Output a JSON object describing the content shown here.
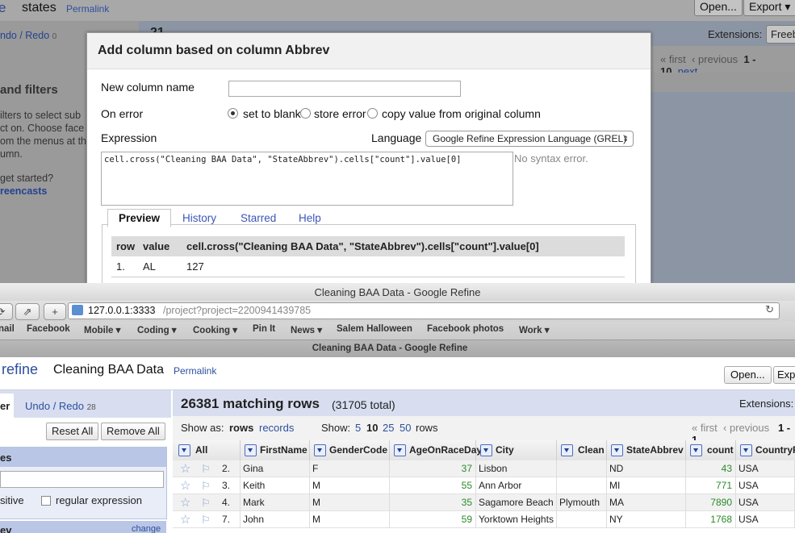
{
  "bg_window": {
    "logo_fragment": "e",
    "project_name": "states",
    "permalink": "Permalink",
    "undo_redo": "ndo / Redo",
    "undo_count": "0",
    "open_btn": "Open...",
    "export_btn": "Export",
    "extensions_label": "Extensions:",
    "extensions_btn": "Freeb",
    "pagination": {
      "first": "« first",
      "previous": "‹ previous",
      "range": "1 - 10",
      "next": "next"
    },
    "facets_heading": "and filters",
    "help_lines": [
      "ilters to select sub",
      "ct on. Choose face",
      "om the menus at th",
      "umn."
    ],
    "get_started": "get started?",
    "screencasts": "reencasts",
    "partial_count": "21"
  },
  "dialog": {
    "title": "Add column based on column Abbrev",
    "new_column_label": "New column name",
    "new_column_value": "",
    "on_error_label": "On error",
    "on_error_options": [
      "set to blank",
      "store error",
      "copy value from original column"
    ],
    "on_error_selected": 0,
    "expression_label": "Expression",
    "language_label": "Language",
    "language_value": "Google Refine Expression Language (GREL)",
    "expression": "cell.cross(\"Cleaning BAA Data\", \"StateAbbrev\").cells[\"count\"].value[0]",
    "syntax_status": "No syntax error.",
    "tabs": [
      "Preview",
      "History",
      "Starred",
      "Help"
    ],
    "active_tab": "Preview",
    "preview": {
      "headers": [
        "row",
        "value",
        "cell.cross(\"Cleaning BAA Data\", \"StateAbbrev\").cells[\"count\"].value[0]"
      ],
      "rows": [
        {
          "row": "1.",
          "value": "AL",
          "result": "127"
        }
      ]
    }
  },
  "browser": {
    "window_title": "Cleaning BAA Data - Google Refine",
    "url_host": "127.0.0.1:3333",
    "url_path": "/project?project=2200941439785",
    "bookmarks": [
      "nail",
      "Facebook",
      "Mobile ▾",
      "Coding ▾",
      "Cooking ▾",
      "Pin It",
      "News ▾",
      "Salem Halloween",
      "Facebook photos",
      "Work ▾"
    ],
    "tab_title": "Cleaning BAA Data - Google Refine"
  },
  "refine": {
    "logo_fragment": "refine",
    "project_name": "Cleaning BAA Data",
    "permalink": "Permalink",
    "open_btn": "Open...",
    "export_btn": "Exp",
    "facet_tab_fragment": "er",
    "undo_redo": "Undo / Redo",
    "undo_count": "28",
    "reset_all": "Reset All",
    "remove_all": "Remove All",
    "facet_title_fragment": "es",
    "facet_search_value": "",
    "case_sensitive_fragment": "sitive",
    "regex_label": "regular expression",
    "facet2_title_fragment": "ev",
    "change_link": "change",
    "matching_rows": "26381 matching rows",
    "total_rows": "(31705 total)",
    "extensions_label": "Extensions:",
    "show_as_label": "Show as:",
    "show_as_rows": "rows",
    "show_as_records": "records",
    "show_label": "Show:",
    "page_sizes": [
      "5",
      "10",
      "25",
      "50"
    ],
    "page_size_selected": "10",
    "rows_label": "rows",
    "pagination": {
      "first": "« first",
      "previous": "‹ previous",
      "range": "1 - 1"
    },
    "columns": [
      "All",
      "FirstName",
      "GenderCode",
      "AgeOnRaceDay",
      "City",
      "Clean",
      "StateAbbrev",
      "count",
      "CountryR"
    ],
    "rows": [
      {
        "idx": "2.",
        "first": "Gina",
        "gender": "F",
        "age": "37",
        "city": "Lisbon",
        "clean": "",
        "state": "ND",
        "count": "43",
        "country": "USA"
      },
      {
        "idx": "3.",
        "first": "Keith",
        "gender": "M",
        "age": "55",
        "city": "Ann Arbor",
        "clean": "",
        "state": "MI",
        "count": "771",
        "country": "USA"
      },
      {
        "idx": "4.",
        "first": "Mark",
        "gender": "M",
        "age": "35",
        "city": "Sagamore Beach",
        "clean": "Plymouth",
        "state": "MA",
        "count": "7890",
        "country": "USA"
      },
      {
        "idx": "7.",
        "first": "John",
        "gender": "M",
        "age": "59",
        "city": "Yorktown Heights",
        "clean": "",
        "state": "NY",
        "count": "1768",
        "country": "USA"
      }
    ]
  }
}
